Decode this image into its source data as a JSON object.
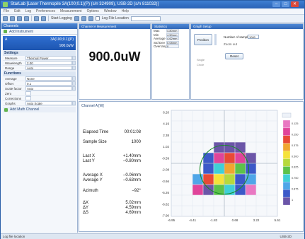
{
  "window": {
    "title": "StarLab   [Laser Thermopile 3A(100;0.1)(P) (s/n 324909), USB-2D (s/n 811032)]",
    "controls": [
      "–",
      "□",
      "✕"
    ]
  },
  "menu": [
    "File",
    "Edit",
    "Log",
    "Preferences",
    "Measurement",
    "Options",
    "Window",
    "Help"
  ],
  "toolbar": {
    "logging": "Start Logging",
    "logfile": "Log File Location"
  },
  "channels": {
    "header": "Channels",
    "add_instrument": "Add Instrument",
    "channel": {
      "label": "A",
      "mode": "3A(100;0.1)(P)",
      "reading": "900.0uW"
    },
    "sections": [
      {
        "title": "Settings",
        "rows": [
          {
            "k": "Measure",
            "v": "Thermal Power"
          },
          {
            "k": "Wavelength",
            "v": "2.00"
          },
          {
            "k": "Range",
            "v": "Auto"
          }
        ]
      },
      {
        "title": "Functions",
        "rows": [
          {
            "k": "Average",
            "v": "None"
          },
          {
            "k": "Offset",
            "v": "0.1"
          },
          {
            "k": "Scale factor",
            "v": "Auto"
          },
          {
            "k": "Zero",
            "v": ""
          },
          {
            "k": "Corrections",
            "v": ""
          },
          {
            "k": "Graphs",
            "v": "Auto Scale"
          }
        ]
      }
    ],
    "add_math": "Add Math Channel"
  },
  "measurement": {
    "header": "Channel A Measurement",
    "value": "900.0uW"
  },
  "statistics": {
    "header": "Statistics",
    "rows": [
      {
        "k": "Max",
        "v": "4.80mm"
      },
      {
        "k": "Min",
        "v": "4.50mm"
      },
      {
        "k": "Average",
        "v": "4.62mm"
      },
      {
        "k": "Std Dev",
        "v": "0.08mm"
      },
      {
        "k": "Overrange",
        "v": "0"
      }
    ]
  },
  "graph_setup": {
    "header": "Graph Setup",
    "mode_button": "Position",
    "samples_label": "Number of samples",
    "samples_value": "1000",
    "hint": "Zoom out",
    "options": [
      "Single",
      "Circle"
    ],
    "reset_button": "Reset"
  },
  "channel_panel": {
    "title": "Channel A [W]",
    "elapsed_label": "Elapsed Time",
    "elapsed_value": "00:01:08",
    "sample_label": "Sample Size",
    "sample_value": "1000",
    "last_x_label": "Last X",
    "last_x_value": "+1.40mm",
    "last_y_label": "Last Y",
    "last_y_value": "–0.80mm",
    "avg_x_label": "Average X",
    "avg_x_value": "–0.06mm",
    "avg_y_label": "Average Y",
    "avg_y_value": "–0.63mm",
    "azimuth_label": "Azimuth",
    "azimuth_value": "–92°",
    "dx_label": "ΔX",
    "dx_value": "5.02mm",
    "dy_label": "ΔY",
    "dy_value": "4.59mm",
    "ds_label": "ΔS",
    "ds_value": "4.69mm"
  },
  "chart_data": {
    "type": "heatmap",
    "title": "",
    "xlabel": "",
    "ylabel": "",
    "x_ticks": [
      "-6.95",
      "-4.41",
      "-1.83",
      "0.68",
      "3.22",
      "5.61"
    ],
    "y_ticks": [
      "6.20",
      "4.19",
      "2.38",
      "1.02",
      "-0.59",
      "-2.08",
      "-3.66",
      "-5.26",
      "-6.82",
      "-7.90"
    ],
    "legend_labels": [
      "0.125",
      "0.250",
      "0.375",
      "0.500",
      "0.625",
      "0.750",
      "0.875",
      "1"
    ],
    "colors": {
      "purple": "#6b55a8",
      "blue": "#3c59c8",
      "lightblue": "#4fa6e8",
      "cyan": "#3fd0d6",
      "green": "#5cc24a",
      "yellowgreen": "#b7d93c",
      "yellow": "#f5e23a",
      "orange": "#f0a630",
      "red": "#e84936",
      "magenta": "#e0449a",
      "pink": "#e978c2",
      "circle": "#1a8a2a"
    },
    "grid": true,
    "cells": [
      {
        "col": 4,
        "row": 3,
        "c": "purple"
      },
      {
        "col": 5,
        "row": 3,
        "c": "purple"
      },
      {
        "col": 6,
        "row": 3,
        "c": "purple"
      },
      {
        "col": 3,
        "row": 4,
        "c": "blue"
      },
      {
        "col": 4,
        "row": 4,
        "c": "magenta"
      },
      {
        "col": 5,
        "row": 4,
        "c": "red"
      },
      {
        "col": 6,
        "row": 4,
        "c": "magenta"
      },
      {
        "col": 7,
        "row": 4,
        "c": "purple"
      },
      {
        "col": 3,
        "row": 5,
        "c": "blue"
      },
      {
        "col": 4,
        "row": 5,
        "c": "cyan"
      },
      {
        "col": 5,
        "row": 5,
        "c": "orange"
      },
      {
        "col": 6,
        "row": 5,
        "c": "green"
      },
      {
        "col": 7,
        "row": 5,
        "c": "blue"
      },
      {
        "col": 2,
        "row": 6,
        "c": "lightblue"
      },
      {
        "col": 3,
        "row": 6,
        "c": "red"
      },
      {
        "col": 4,
        "row": 6,
        "c": "yellow"
      },
      {
        "col": 5,
        "row": 6,
        "c": "yellowgreen"
      },
      {
        "col": 6,
        "row": 6,
        "c": "blue"
      },
      {
        "col": 7,
        "row": 6,
        "c": "lightblue"
      },
      {
        "col": 2,
        "row": 7,
        "c": "magenta"
      },
      {
        "col": 3,
        "row": 7,
        "c": "purple"
      },
      {
        "col": 4,
        "row": 7,
        "c": "green"
      },
      {
        "col": 5,
        "row": 7,
        "c": "cyan"
      },
      {
        "col": 6,
        "row": 7,
        "c": "blue"
      },
      {
        "col": 7,
        "row": 7,
        "c": "pink"
      }
    ],
    "circle": {
      "cx": 5.0,
      "cy": 5.6,
      "r": 2.3
    }
  },
  "status": {
    "left": "Log file location",
    "right": "USB-2D"
  }
}
